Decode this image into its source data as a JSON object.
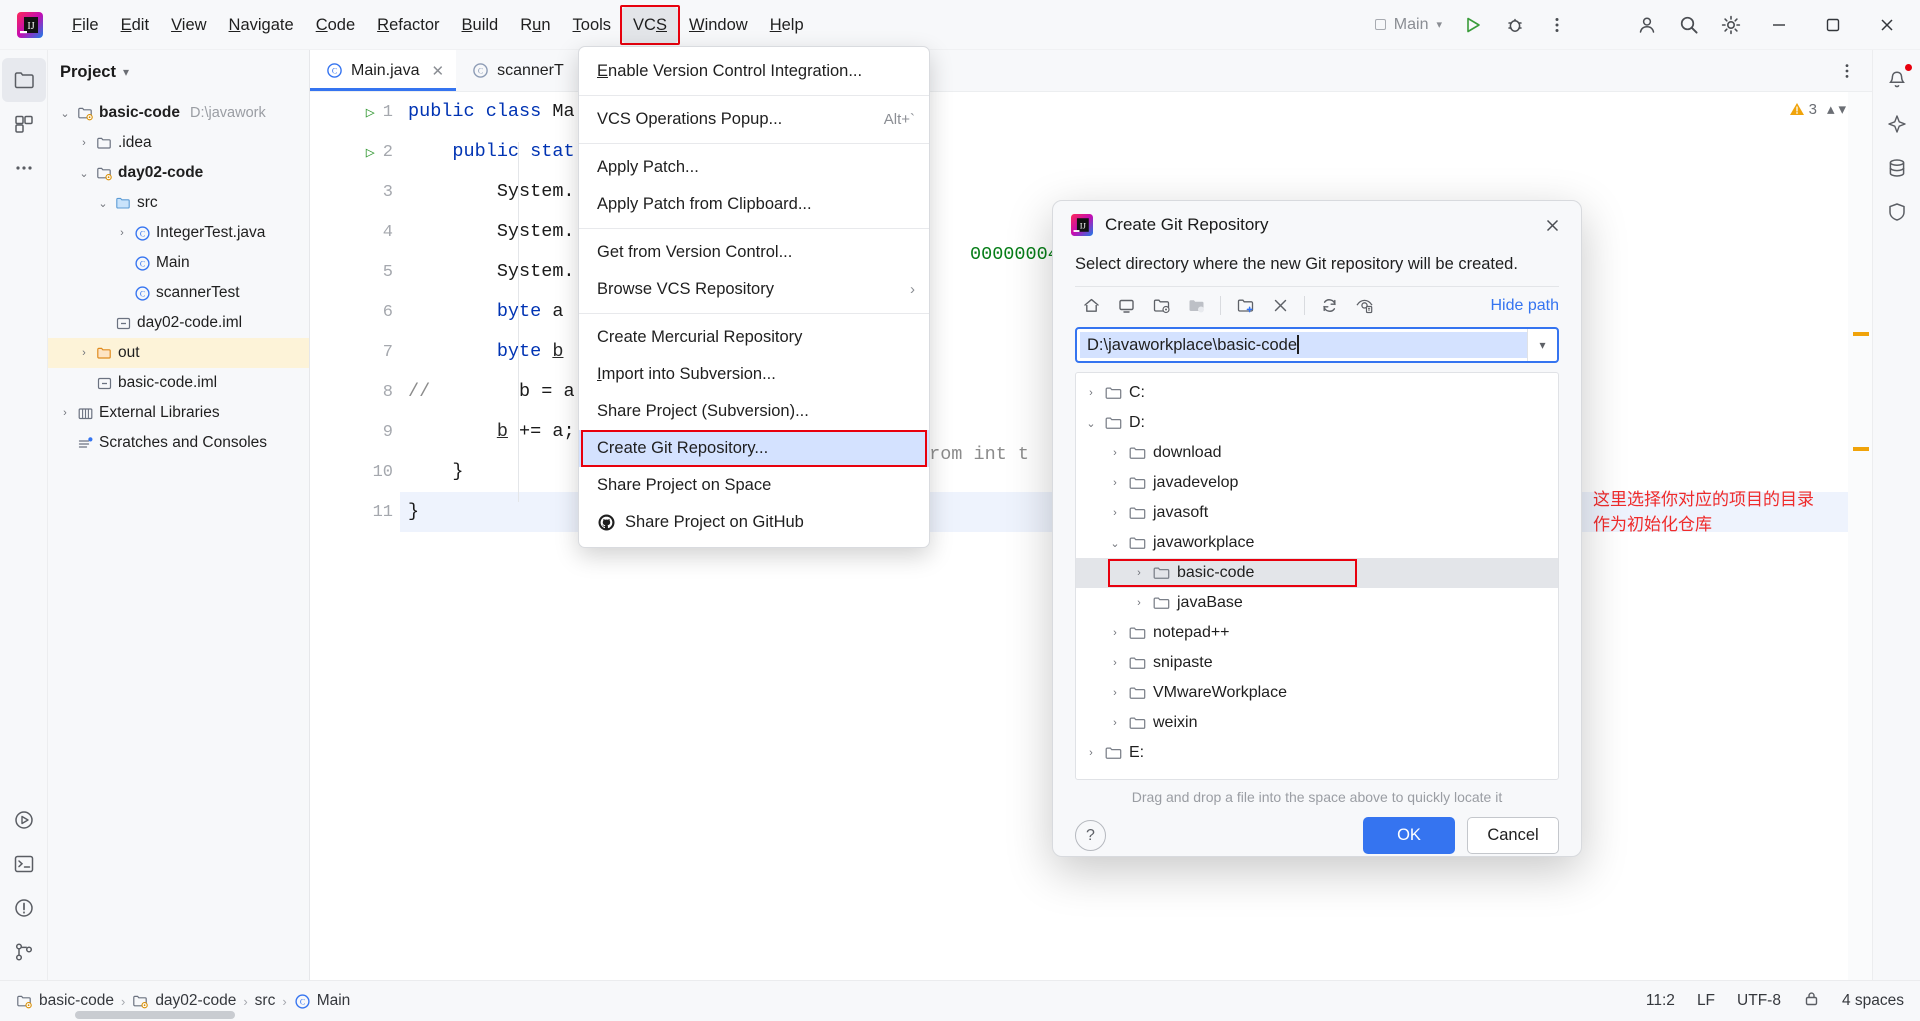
{
  "app": {
    "logo_name": "intellij-idea-logo"
  },
  "menubar": {
    "items": [
      {
        "label": "File",
        "mn": "F"
      },
      {
        "label": "Edit",
        "mn": "E"
      },
      {
        "label": "View",
        "mn": "V"
      },
      {
        "label": "Navigate",
        "mn": "N"
      },
      {
        "label": "Code",
        "mn": "C"
      },
      {
        "label": "Refactor",
        "mn": "R"
      },
      {
        "label": "Build",
        "mn": "B"
      },
      {
        "label": "Run",
        "mn": "u"
      },
      {
        "label": "Tools",
        "mn": "T"
      },
      {
        "label": "VCS",
        "mn": "S"
      },
      {
        "label": "Window",
        "mn": "W"
      },
      {
        "label": "Help",
        "mn": "H"
      }
    ],
    "active_index": 9
  },
  "toolbar_right": {
    "run_config": "Main",
    "accent": "#3574f0"
  },
  "vcs_menu": {
    "items": [
      {
        "label": "Enable Version Control Integration...",
        "accel": "",
        "sep_after": true,
        "icon": ""
      },
      {
        "label": "VCS Operations Popup...",
        "accel": "Alt+`",
        "sep_after": true,
        "icon": ""
      },
      {
        "label": "Apply Patch...",
        "accel": "",
        "sep_after": false,
        "icon": ""
      },
      {
        "label": "Apply Patch from Clipboard...",
        "accel": "",
        "sep_after": true,
        "icon": ""
      },
      {
        "label": "Get from Version Control...",
        "accel": "",
        "sep_after": false,
        "icon": ""
      },
      {
        "label": "Browse VCS Repository",
        "accel": "›",
        "sep_after": true,
        "icon": ""
      },
      {
        "label": "Create Mercurial Repository",
        "accel": "",
        "sep_after": false,
        "icon": ""
      },
      {
        "label": "Import into Subversion...",
        "accel": "",
        "sep_after": false,
        "icon": ""
      },
      {
        "label": "Share Project (Subversion)...",
        "accel": "",
        "sep_after": false,
        "icon": ""
      },
      {
        "label": "Create Git Repository...",
        "accel": "",
        "sep_after": false,
        "icon": "",
        "selected": true
      },
      {
        "label": "Share Project on Space",
        "accel": "",
        "sep_after": false,
        "icon": ""
      },
      {
        "label": "Share Project on GitHub",
        "accel": "",
        "sep_after": false,
        "icon": "github-icon"
      }
    ]
  },
  "project_panel": {
    "title": "Project",
    "tree": [
      {
        "indent": 0,
        "arrow": "down",
        "icon": "module-icon",
        "label": "basic-code",
        "bold": true,
        "path": "D:\\javawork"
      },
      {
        "indent": 1,
        "arrow": "right",
        "icon": "folder-icon",
        "label": ".idea",
        "bold": false
      },
      {
        "indent": 1,
        "arrow": "down",
        "icon": "module-icon",
        "label": "day02-code",
        "bold": true
      },
      {
        "indent": 2,
        "arrow": "down",
        "icon": "source-folder-icon",
        "label": "src",
        "bold": false
      },
      {
        "indent": 3,
        "arrow": "right",
        "icon": "class-icon",
        "label": "IntegerTest.java",
        "bold": false
      },
      {
        "indent": 3,
        "arrow": "none",
        "icon": "class-icon",
        "label": "Main",
        "bold": false
      },
      {
        "indent": 3,
        "arrow": "none",
        "icon": "class-icon",
        "label": "scannerTest",
        "bold": false
      },
      {
        "indent": 2,
        "arrow": "none",
        "icon": "iml-icon",
        "label": "day02-code.iml",
        "bold": false
      },
      {
        "indent": 1,
        "arrow": "right",
        "icon": "excluded-folder-icon",
        "label": "out",
        "bold": false,
        "highlight": "amber"
      },
      {
        "indent": 1,
        "arrow": "none",
        "icon": "iml-icon",
        "label": "basic-code.iml",
        "bold": false
      },
      {
        "indent": 0,
        "arrow": "right",
        "icon": "library-icon",
        "label": "External Libraries",
        "bold": false
      },
      {
        "indent": 0,
        "arrow": "none",
        "icon": "scratches-icon",
        "label": "Scratches and Consoles",
        "bold": false
      }
    ]
  },
  "editor": {
    "tabs": [
      {
        "label": "Main.java",
        "icon": "class-icon",
        "active": true,
        "closable": true
      },
      {
        "label": "scannerT",
        "icon": "class-icon",
        "active": false,
        "closable": false
      }
    ],
    "warning_count": "3",
    "lines": [
      {
        "n": "1",
        "run": true,
        "html": "<span class=\"kw\">public class</span> Ma"
      },
      {
        "n": "2",
        "run": true,
        "html": "    <span class=\"kw\">public stat</span>"
      },
      {
        "n": "3",
        "run": false,
        "html": "        System."
      },
      {
        "n": "4",
        "run": false,
        "html": "        System."
      },
      {
        "n": "5",
        "run": false,
        "html": "        System."
      },
      {
        "n": "6",
        "run": false,
        "html": "        <span class=\"kw\">byte</span> a "
      },
      {
        "n": "7",
        "run": false,
        "html": "        <span class=\"kw\">byte</span> <span class=\"fld\">b</span> "
      },
      {
        "n": "8",
        "run": false,
        "html": "<span class=\"cmt\">//</span>        b = a"
      },
      {
        "n": "9",
        "run": false,
        "html": "        <span class=\"fld\">b</span> += a;"
      },
      {
        "n": "10",
        "run": false,
        "html": "    }"
      },
      {
        "n": "11",
        "run": false,
        "html": "}",
        "hl": true
      }
    ],
    "fragment_right": "00000004",
    "fragment_comment": "from int t"
  },
  "annotation": {
    "line1": "这里选择你对应的项目的目录",
    "line2": "作为初始化仓库",
    "color": "#ef2b2b"
  },
  "dialog": {
    "title": "Create Git Repository",
    "icon": "intellij-idea-logo",
    "close_icon": "close-icon",
    "subtitle": "Select directory where the new Git repository will be created.",
    "toolbar_icons": [
      {
        "name": "home-icon",
        "dim": false
      },
      {
        "name": "desktop-icon",
        "dim": false
      },
      {
        "name": "project-folder-icon",
        "dim": false
      },
      {
        "name": "module-folder-icon",
        "dim": true
      },
      {
        "name": "new-folder-icon",
        "dim": false
      },
      {
        "name": "delete-icon",
        "dim": false
      },
      {
        "name": "refresh-icon",
        "dim": false
      },
      {
        "name": "show-hidden-icon",
        "dim": false
      }
    ],
    "hide_path_label": "Hide path",
    "path_value": "D:\\javaworkplace\\basic-code",
    "path_dropdown_icon": "chevron-down-icon",
    "tree": [
      {
        "indent": 0,
        "arrow": "right",
        "label": "C:"
      },
      {
        "indent": 0,
        "arrow": "down",
        "label": "D:"
      },
      {
        "indent": 1,
        "arrow": "right",
        "label": "download"
      },
      {
        "indent": 1,
        "arrow": "right",
        "label": "javadevelop"
      },
      {
        "indent": 1,
        "arrow": "right",
        "label": "javasoft"
      },
      {
        "indent": 1,
        "arrow": "down",
        "label": "javaworkplace"
      },
      {
        "indent": 2,
        "arrow": "right",
        "label": "basic-code",
        "selected": true,
        "redbox": true
      },
      {
        "indent": 2,
        "arrow": "right",
        "label": "javaBase"
      },
      {
        "indent": 1,
        "arrow": "right",
        "label": "notepad++"
      },
      {
        "indent": 1,
        "arrow": "right",
        "label": "snipaste"
      },
      {
        "indent": 1,
        "arrow": "right",
        "label": "VMwareWorkplace"
      },
      {
        "indent": 1,
        "arrow": "right",
        "label": "weixin"
      },
      {
        "indent": 0,
        "arrow": "right",
        "label": "E:"
      }
    ],
    "drop_hint": "Drag and drop a file into the space above to quickly locate it",
    "help_label": "?",
    "ok_label": "OK",
    "cancel_label": "Cancel"
  },
  "statusbar": {
    "breadcrumbs": [
      {
        "label": "basic-code",
        "icon": "module-icon"
      },
      {
        "label": "day02-code",
        "icon": "module-icon"
      },
      {
        "label": "src",
        "icon": ""
      },
      {
        "label": "Main",
        "icon": "class-icon"
      }
    ],
    "caret_position": "11:2",
    "line_separator": "LF",
    "encoding": "UTF-8",
    "indent": "4 spaces",
    "lock_icon": "lock-icon",
    "branch_icon": "git-branch-icon"
  }
}
